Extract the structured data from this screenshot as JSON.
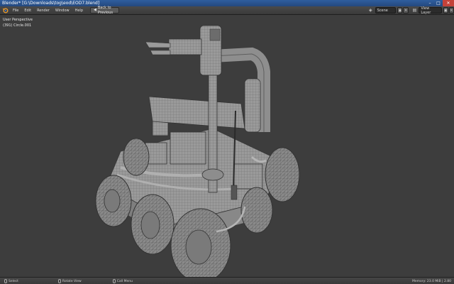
{
  "window": {
    "title": "Blender* [G:\\Downloads\\tog\\eod\\EOD7.blend]"
  },
  "header": {
    "menus": [
      "File",
      "Edit",
      "Render",
      "Window",
      "Help"
    ],
    "back_button": "Back to Previous",
    "scene": "Scene",
    "view_layer": "View Layer"
  },
  "viewport": {
    "view_name": "User Perspective",
    "object_label": "(391) Circle.001"
  },
  "statusbar": {
    "select": "Select",
    "rotate": "Rotate View",
    "menu": "Call Menu",
    "memory": "Memory: 23.0 MiB | 2.80"
  },
  "colors": {
    "background": "#3d3d3d",
    "titlebar": "#2f5d9e",
    "model": "#9e9e9e"
  }
}
